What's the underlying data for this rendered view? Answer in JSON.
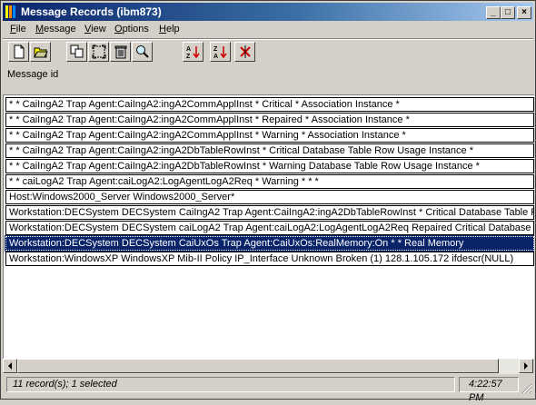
{
  "window": {
    "title": "Message Records (ibm873)"
  },
  "menu": [
    {
      "underline": "F",
      "rest": "ile"
    },
    {
      "underline": "M",
      "rest": "essage"
    },
    {
      "underline": "V",
      "rest": "iew"
    },
    {
      "underline": "O",
      "rest": "ptions"
    },
    {
      "underline": "H",
      "rest": "elp"
    }
  ],
  "toolbar": {
    "icons": [
      "new-document-icon",
      "open-folder-icon",
      "copy-icon",
      "select-all-icon",
      "delete-icon",
      "find-icon",
      "sort-ascending-icon",
      "sort-descending-icon",
      "clear-sort-icon"
    ]
  },
  "header": {
    "column_label": "Message id"
  },
  "rows": [
    "* * CaiIngA2 Trap Agent:CaiIngA2:ingA2CommApplInst * Critical * Association Instance *",
    "* * CaiIngA2 Trap Agent:CaiIngA2:ingA2CommApplInst * Repaired * Association Instance *",
    "* * CaiIngA2 Trap Agent:CaiIngA2:ingA2CommApplInst * Warning * Association Instance *",
    "* * CaiIngA2 Trap Agent:CaiIngA2:ingA2DbTableRowInst * Critical Database Table Row Usage Instance *",
    "* * CaiIngA2 Trap Agent:CaiIngA2:ingA2DbTableRowInst * Warning Database Table Row Usage Instance *",
    "* * caiLogA2 Trap Agent:caiLogA2:LogAgentLogA2Req * Warning * * *",
    "Host:Windows2000_Server Windows2000_Server*",
    "Workstation:DECSystem DECSystem CaiIngA2 Trap Agent:CaiIngA2:ingA2DbTableRowInst * Critical Database Table Row",
    "Workstation:DECSystem DECSystem caiLogA2 Trap Agent:caiLogA2:LogAgentLogA2Req Repaired Critical Database Not",
    "Workstation:DECSystem DECSystem CaiUxOs Trap Agent:CaiUxOs:RealMemory:On * * Real Memory",
    "Workstation:WindowsXP WindowsXP Mib-II Policy IP_Interface Unknown Broken (1) 128.1.105.172 ifdescr(NULL)"
  ],
  "selected_row": 9,
  "status": {
    "records": "11 record(s); 1 selected",
    "time": "4:22:57 PM"
  }
}
